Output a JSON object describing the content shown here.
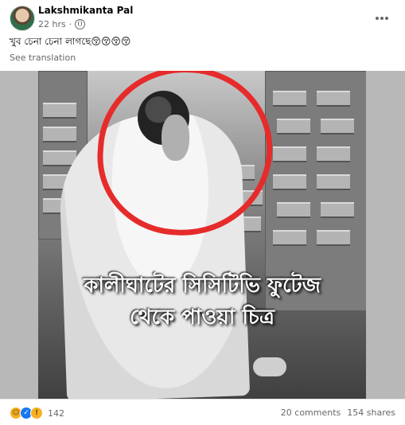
{
  "post": {
    "author": "Lakshmikanta Pal",
    "time": "22 hrs",
    "caption": "খুব চেনা চেনা লাগছে😚😚😚😚",
    "translation_label": "See translation",
    "image_text_line1": "কালীঘাটের সিসিটিভি ফুটেজ",
    "image_text_line2": "থেকে পাওয়া চিত্র",
    "reaction_count": "142",
    "comments": "20 comments",
    "shares": "154 shares"
  },
  "icons": {
    "privacy": "globe-icon",
    "more": "more-options-icon",
    "reactions": [
      "haha-icon",
      "like-icon",
      "wow-icon"
    ]
  },
  "colors": {
    "highlight": "#e62b2b",
    "meta": "#65676b",
    "like": "#1877f2"
  }
}
